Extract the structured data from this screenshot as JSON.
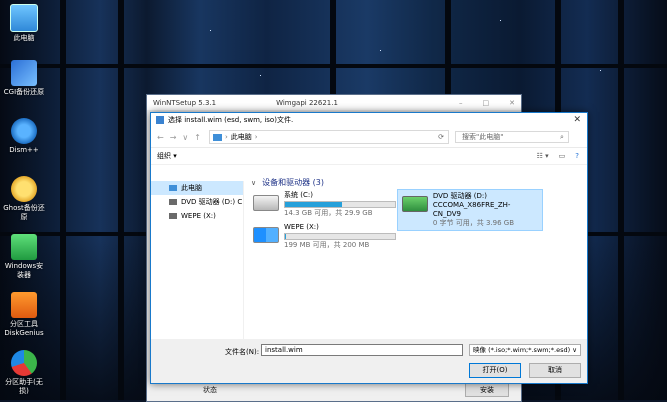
{
  "desktop": {
    "icons": [
      {
        "label": "此电脑"
      },
      {
        "label": "CGI备份还原"
      },
      {
        "label": "Dism++"
      },
      {
        "label": "Ghost备份还原"
      },
      {
        "label": "Windows安装器"
      },
      {
        "label": "分区工具DiskGenius"
      },
      {
        "label": "分区助手(无损)"
      }
    ]
  },
  "back_window": {
    "title": "WinNTSetup 5.3.1",
    "subtitle": "Wimgapi 22621.1",
    "status_label": "状态",
    "install_label": "安装"
  },
  "dialog": {
    "title": "选择 install.wim (esd, swm, iso)文件.",
    "address": "此电脑",
    "search_placeholder": "搜索\"此电脑\"",
    "organize_label": "组织",
    "sidebar": [
      {
        "label": "此电脑"
      },
      {
        "label": "DVD 驱动器 (D:) C"
      },
      {
        "label": "WEPE (X:)"
      }
    ],
    "group_header": "设备和驱动器 (3)",
    "drives": [
      {
        "name": "系统 (C:)",
        "free": "14.3 GB 可用，共 29.9 GB",
        "used_fraction": 0.52
      },
      {
        "name": "WEPE (X:)",
        "free": "199 MB 可用，共 200 MB",
        "used_fraction": 0.01
      },
      {
        "name": "DVD 驱动器 (D:)",
        "label2": "CCCOMA_X86FRE_ZH-CN_DV9",
        "free": "0 字节 可用，共 3.96 GB"
      }
    ],
    "filename_label": "文件名(N):",
    "filename_value": "install.wim",
    "filetype_value": "映像 (*.iso;*.wim;*.swm;*.esd) ∨",
    "open_label": "打开(O)",
    "cancel_label": "取消"
  },
  "colors": {
    "accent": "#26a0da",
    "selection": "#cce8ff",
    "title_border": "#1979ca"
  }
}
